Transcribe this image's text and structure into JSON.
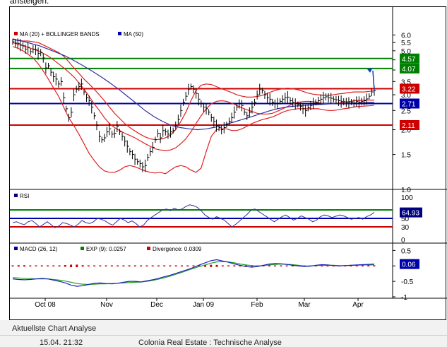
{
  "top_caption": "ansteigen.",
  "footer": {
    "title": "Aktuellste Chart Analyse",
    "time": "15.04. 21:32",
    "description": "Colonia Real Estate : Technische Analyse"
  },
  "chart_data": [
    {
      "type": "line",
      "panel": "price",
      "legend": [
        {
          "label": "MA (20) + BOLLINGER BANDS",
          "color": "#cc0000"
        },
        {
          "label": "MA (50)",
          "color": "#0000aa"
        }
      ],
      "y_scale": "log",
      "ylim": [
        1.0,
        6.6
      ],
      "yticks": [
        "6.0",
        "5.5",
        "5.0",
        "4.5",
        "4.0",
        "3.5",
        "3.0",
        "2.5",
        "2.0",
        "1.5",
        "1.0"
      ],
      "months": [
        "Oct 08",
        "Nov",
        "Dec",
        "Jan 09",
        "Feb",
        "Mar",
        "Apr"
      ],
      "x": [
        0,
        2,
        4,
        6,
        8,
        10,
        12,
        14,
        16,
        18,
        20,
        22,
        24,
        26,
        28,
        30,
        32,
        34,
        36,
        38,
        40,
        42,
        44,
        46,
        48,
        50,
        52,
        54,
        56,
        58,
        60,
        62,
        64,
        66,
        68,
        70,
        72,
        74,
        76,
        78,
        80,
        82,
        84,
        86,
        88,
        90,
        92,
        94,
        96,
        98,
        100,
        102,
        104,
        106,
        108,
        110,
        112,
        114,
        116,
        118,
        120,
        122,
        124,
        126,
        128,
        130,
        132,
        134,
        136,
        138,
        140,
        142,
        144,
        146,
        148,
        150,
        152,
        154,
        156,
        158,
        160,
        162,
        164,
        166,
        168,
        170,
        172,
        174,
        176,
        178,
        180,
        182,
        184,
        186,
        188,
        190,
        192,
        194,
        196,
        198,
        200,
        202,
        204,
        206,
        208,
        210,
        212,
        214,
        216,
        218,
        220,
        222,
        224,
        226,
        228,
        230,
        232,
        234,
        236,
        238,
        240,
        242,
        244,
        246,
        248,
        250,
        252,
        254,
        256,
        258,
        260,
        262,
        264,
        266,
        268,
        270,
        272,
        274,
        276,
        278,
        280,
        282,
        284,
        286,
        288,
        290,
        292,
        294,
        296,
        298,
        300,
        302,
        304,
        306,
        308,
        310,
        312,
        314,
        316,
        318,
        320,
        322,
        324,
        326,
        328,
        330,
        332,
        334,
        336,
        338,
        340,
        342,
        344,
        346,
        348,
        350,
        352,
        354,
        356,
        358,
        360,
        362,
        364,
        366,
        368,
        370,
        372,
        374,
        376,
        378,
        380,
        382,
        384,
        386,
        388,
        390,
        392,
        394,
        396,
        398,
        400,
        402,
        404,
        406,
        408,
        410,
        412,
        414,
        416,
        418,
        420,
        422,
        424,
        426,
        428,
        430,
        432,
        434,
        436,
        438,
        440,
        442,
        444,
        446,
        448,
        450,
        452,
        454,
        456,
        458,
        460,
        462,
        464,
        466,
        468,
        470,
        472,
        474,
        476,
        478,
        480,
        482,
        484,
        486,
        488,
        490,
        492,
        494,
        496,
        498,
        500,
        502,
        504,
        506,
        508,
        510,
        512,
        514,
        516
      ],
      "price": [
        5.55,
        5.47,
        5.45,
        5.35,
        5.3,
        5.1,
        5.2,
        4.95,
        5.1,
        5.05,
        4.85,
        4.9,
        4.6,
        4.1,
        4.2,
        3.9,
        3.7,
        3.6,
        3.4,
        3.5,
        2.9,
        2.55,
        2.3,
        2.45,
        3.0,
        3.2,
        3.3,
        3.4,
        3.1,
        2.9,
        2.8,
        2.6,
        2.35,
        2.1,
        1.85,
        1.78,
        1.82,
        1.95,
        2.02,
        1.9,
        1.92,
        2.08,
        1.95,
        1.85,
        1.75,
        1.65,
        1.55,
        1.5,
        1.42,
        1.38,
        1.35,
        1.3,
        1.32,
        1.45,
        1.55,
        1.63,
        1.78,
        1.92,
        1.82,
        1.98,
        1.95,
        1.9,
        1.95,
        1.98,
        2.1,
        2.25,
        2.5,
        2.75,
        2.95,
        3.2,
        3.3,
        3.2,
        3.05,
        2.85,
        2.7,
        2.6,
        2.55,
        2.45,
        2.3,
        2.2,
        2.1,
        2.05,
        2.0,
        2.05,
        2.12,
        2.2,
        2.3,
        2.45,
        2.6,
        2.7,
        2.65,
        2.45,
        2.35,
        2.45,
        2.6,
        2.75,
        3.0,
        3.2,
        3.15,
        3.0,
        2.9,
        2.85,
        2.75,
        2.7,
        2.72,
        2.78,
        2.85,
        2.9,
        2.92,
        2.8,
        2.75,
        2.7,
        2.68,
        2.62,
        2.55,
        2.5,
        2.58,
        2.65,
        2.72,
        2.75,
        2.8,
        2.85,
        2.9,
        2.93,
        2.9,
        2.88,
        2.85,
        2.83,
        2.8,
        2.78,
        2.77,
        2.75,
        2.74,
        2.76,
        2.72,
        2.78,
        2.75,
        2.78,
        2.8,
        2.86,
        2.95,
        3.1,
        3.15
      ],
      "ma20": [
        5.5,
        5.4,
        5.3,
        5.2,
        5.1,
        5.0,
        4.85,
        4.7,
        4.5,
        4.3,
        4.1,
        3.9,
        3.7,
        3.45,
        3.2,
        2.95,
        2.7,
        2.5,
        2.3,
        2.15,
        2.05,
        1.98,
        1.92,
        1.87,
        1.82,
        1.76,
        1.7,
        1.65,
        1.6,
        1.58,
        1.57,
        1.58,
        1.62,
        1.7,
        1.8,
        1.95,
        2.15,
        2.35,
        2.55,
        2.7,
        2.78,
        2.8,
        2.78,
        2.72,
        2.65,
        2.58,
        2.52,
        2.47,
        2.42,
        2.4,
        2.4,
        2.42,
        2.48,
        2.55,
        2.62,
        2.7,
        2.75,
        2.77,
        2.78,
        2.77,
        2.74,
        2.71,
        2.7,
        2.71,
        2.73,
        2.75,
        2.77,
        2.8,
        2.81,
        2.82,
        2.82,
        2.82
      ],
      "upper": [
        5.75,
        5.65,
        5.6,
        5.6,
        5.55,
        5.5,
        5.35,
        5.2,
        5.05,
        4.9,
        4.7,
        4.4,
        4.1,
        3.85,
        3.6,
        3.4,
        3.2,
        3.0,
        2.8,
        2.6,
        2.42,
        2.28,
        2.15,
        2.05,
        1.97,
        1.9,
        1.84,
        1.8,
        1.78,
        1.79,
        1.82,
        1.88,
        2.0,
        2.2,
        2.45,
        2.8,
        3.15,
        3.35,
        3.4,
        3.38,
        3.3,
        3.22,
        3.15,
        3.08,
        3.0,
        2.95,
        2.92,
        2.92,
        2.94,
        2.98,
        3.05,
        3.12,
        3.18,
        3.22,
        3.24,
        3.22,
        3.18,
        3.12,
        3.06,
        3.02,
        3.0,
        2.98,
        2.98,
        3.0,
        3.03,
        3.05,
        3.08,
        3.1,
        3.1,
        3.1,
        3.12,
        3.15
      ],
      "lower": [
        5.25,
        5.15,
        5.0,
        4.8,
        4.6,
        4.3,
        3.95,
        3.6,
        3.25,
        2.95,
        2.6,
        2.3,
        2.1,
        1.9,
        1.7,
        1.52,
        1.4,
        1.3,
        1.24,
        1.22,
        1.22,
        1.25,
        1.3,
        1.32,
        1.3,
        1.27,
        1.24,
        1.22,
        1.21,
        1.22,
        1.2,
        1.25,
        1.3,
        1.32,
        1.3,
        1.25,
        1.22,
        1.28,
        1.55,
        1.85,
        2.0,
        2.02,
        2.02,
        1.98,
        1.98,
        2.02,
        2.08,
        2.15,
        2.2,
        2.25,
        2.28,
        2.32,
        2.38,
        2.45,
        2.5,
        2.53,
        2.55,
        2.55,
        2.55,
        2.55,
        2.55,
        2.52,
        2.5,
        2.5,
        2.52,
        2.55,
        2.57,
        2.6,
        2.62,
        2.63,
        2.64,
        2.66
      ],
      "ma50": [
        5.7,
        5.6,
        5.45,
        5.3,
        5.1,
        4.9,
        4.7,
        4.45,
        4.2,
        3.95,
        3.7,
        3.45,
        3.2,
        2.95,
        2.72,
        2.5,
        2.33,
        2.2,
        2.1,
        2.05,
        2.02,
        2.0,
        2.02,
        2.06,
        2.12,
        2.18,
        2.25,
        2.32,
        2.4,
        2.48,
        2.55,
        2.6,
        2.63,
        2.65,
        2.67,
        2.68,
        2.7,
        2.71,
        2.72,
        2.73,
        2.74,
        2.75
      ],
      "levels": [
        {
          "value": "4.57",
          "color": "#008000"
        },
        {
          "value": "4.07",
          "color": "#008000"
        },
        {
          "value": "3.22",
          "color": "#cc0000"
        },
        {
          "value": "2.71",
          "color": "#0000aa"
        },
        {
          "value": "2.11",
          "color": "#cc0000"
        }
      ]
    },
    {
      "type": "line",
      "panel": "rsi",
      "legend": [
        {
          "label": "RSI",
          "color": "#000080"
        }
      ],
      "ylim": [
        0,
        100
      ],
      "yticks": [
        "100",
        "50",
        "30",
        "0"
      ],
      "levels": [
        {
          "value": "70",
          "color": "#008000"
        },
        {
          "value": "50",
          "color": "#0000aa"
        },
        {
          "value": "30",
          "color": "#cc0000"
        }
      ],
      "current_label": "64.93",
      "values": [
        40,
        42,
        38,
        35,
        42,
        45,
        38,
        30,
        36,
        42,
        35,
        28,
        32,
        40,
        38,
        34,
        30,
        36,
        45,
        40,
        38,
        42,
        50,
        48,
        44,
        38,
        34,
        42,
        50,
        46,
        40,
        44,
        38,
        30,
        34,
        45,
        52,
        58,
        64,
        70,
        72,
        68,
        74,
        70,
        72,
        78,
        82,
        80,
        76,
        68,
        58,
        52,
        48,
        54,
        50,
        46,
        38,
        30,
        36,
        44,
        52,
        60,
        70,
        72,
        66,
        60,
        54,
        48,
        42,
        48,
        54,
        58,
        52,
        46,
        50,
        56,
        52,
        48,
        42,
        46,
        54,
        58,
        56,
        52,
        55,
        58,
        56,
        52,
        48,
        50,
        52,
        48,
        54,
        58,
        64
      ]
    },
    {
      "type": "line",
      "panel": "macd",
      "legend": [
        {
          "label": "MACD (26, 12)",
          "color": "#0000aa"
        },
        {
          "label": "EXP (9): 0.0257",
          "color": "#008000"
        },
        {
          "label": "Divergence: 0.0309",
          "color": "#cc0000"
        }
      ],
      "ylim": [
        -1.0,
        0.6
      ],
      "yticks": [
        "0.5",
        "0",
        "-0.5",
        "-1"
      ],
      "current_label": "0.06",
      "macd": [
        -0.42,
        -0.44,
        -0.45,
        -0.44,
        -0.42,
        -0.4,
        -0.42,
        -0.46,
        -0.5,
        -0.55,
        -0.62,
        -0.66,
        -0.64,
        -0.6,
        -0.56,
        -0.55,
        -0.57,
        -0.58,
        -0.56,
        -0.53,
        -0.5,
        -0.5,
        -0.52,
        -0.48,
        -0.45,
        -0.4,
        -0.35,
        -0.3,
        -0.24,
        -0.18,
        -0.12,
        -0.05,
        0.03,
        0.1,
        0.17,
        0.2,
        0.16,
        0.12,
        0.06,
        0.02,
        -0.02,
        -0.04,
        -0.02,
        0.02,
        0.06,
        0.08,
        0.07,
        0.05,
        0.02,
        0.0,
        -0.02,
        -0.01,
        0.02,
        0.04,
        0.03,
        0.01,
        0.0,
        0.01,
        0.02,
        0.03,
        0.04,
        0.05,
        0.06
      ],
      "signal": [
        -0.38,
        -0.39,
        -0.4,
        -0.41,
        -0.42,
        -0.42,
        -0.42,
        -0.44,
        -0.46,
        -0.49,
        -0.53,
        -0.57,
        -0.59,
        -0.6,
        -0.59,
        -0.58,
        -0.58,
        -0.57,
        -0.56,
        -0.55,
        -0.54,
        -0.53,
        -0.52,
        -0.5,
        -0.47,
        -0.43,
        -0.38,
        -0.33,
        -0.27,
        -0.21,
        -0.14,
        -0.08,
        -0.02,
        0.03,
        0.09,
        0.13,
        0.14,
        0.13,
        0.1,
        0.06,
        0.03,
        0.01,
        0.0,
        0.01,
        0.03,
        0.05,
        0.06,
        0.05,
        0.04,
        0.02,
        0.0,
        0.0,
        0.01,
        0.02,
        0.02,
        0.02,
        0.01,
        0.01,
        0.02,
        0.02,
        0.03,
        0.03,
        0.03
      ]
    }
  ]
}
